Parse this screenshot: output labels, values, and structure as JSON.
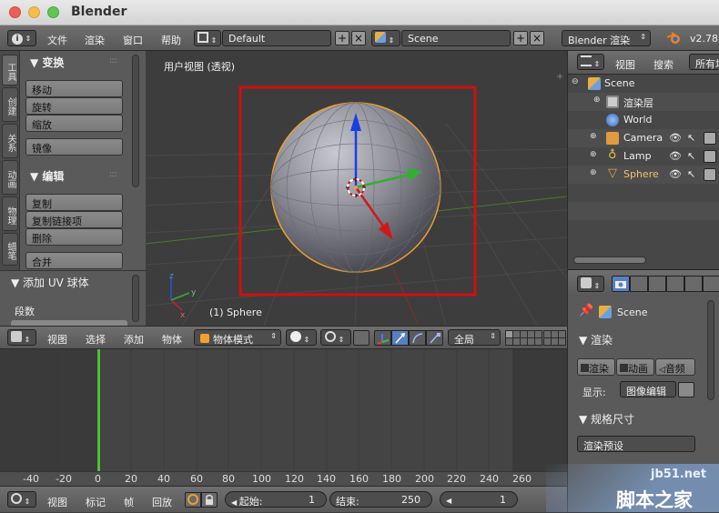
{
  "window": {
    "title": "Blender"
  },
  "info_header": {
    "menus": [
      "文件",
      "渲染",
      "窗口",
      "帮助"
    ],
    "screen_layout": "Default",
    "scene": "Scene",
    "render_engine": "Blender 渲染",
    "version": "v2.78"
  },
  "tool_shelf": {
    "tabs": [
      "工具",
      "创建",
      "关系",
      "动画",
      "物理",
      "蜡笔"
    ],
    "transform_header": "▼ 变换",
    "transform_buttons": [
      "移动",
      "旋转",
      "缩放"
    ],
    "mirror_button": "镜像",
    "edit_header": "▼ 编辑",
    "edit_buttons": [
      "复制",
      "复制链接项",
      "删除"
    ],
    "join_button": "合并",
    "operator_header": "▼ 添加 UV 球体",
    "segments_label": "段数"
  },
  "viewport": {
    "view_label": "用户视图 (透视)",
    "object_label": "(1) Sphere"
  },
  "viewport_header": {
    "menus": [
      "视图",
      "选择",
      "添加",
      "物体"
    ],
    "mode": "物体模式",
    "pivot": "全局"
  },
  "timeline": {
    "ruler_ticks": [
      "-40",
      "-20",
      "0",
      "20",
      "40",
      "60",
      "80",
      "100",
      "120",
      "140",
      "160",
      "180",
      "200",
      "220",
      "240",
      "260"
    ],
    "menus": [
      "视图",
      "标记",
      "帧",
      "回放"
    ],
    "start_label": "起始:",
    "start_value": "1",
    "end_label": "结束:",
    "end_value": "250",
    "current_frame": "1",
    "current_frame_marker": 1
  },
  "outliner": {
    "menus": [
      "视图",
      "搜索",
      "所有场"
    ],
    "items": [
      {
        "label": "Scene",
        "icon": "scene-icon"
      },
      {
        "label": "渲染层",
        "icon": "render-layers-icon"
      },
      {
        "label": "World",
        "icon": "world-icon"
      },
      {
        "label": "Camera",
        "icon": "camera-icon"
      },
      {
        "label": "Lamp",
        "icon": "lamp-icon"
      },
      {
        "label": "Sphere",
        "icon": "mesh-icon"
      }
    ]
  },
  "properties": {
    "context": "Scene",
    "render_header": "▼ 渲染",
    "render_buttons": [
      "渲染",
      "动画",
      "音频"
    ],
    "display_label": "显示:",
    "display_value": "图像编辑",
    "dimensions_header": "▼ 规格尺寸",
    "render_preset": "渲染预设"
  },
  "watermark": {
    "site": "jb51.net",
    "brand": "脚本之家"
  },
  "colors": {
    "accent_orange": "#f0a030",
    "selection_box": "#d01010",
    "timeline_cursor": "#50c030",
    "axis_blue": "#1a3fe0",
    "axis_green": "#30b030",
    "axis_red": "#d01818"
  }
}
